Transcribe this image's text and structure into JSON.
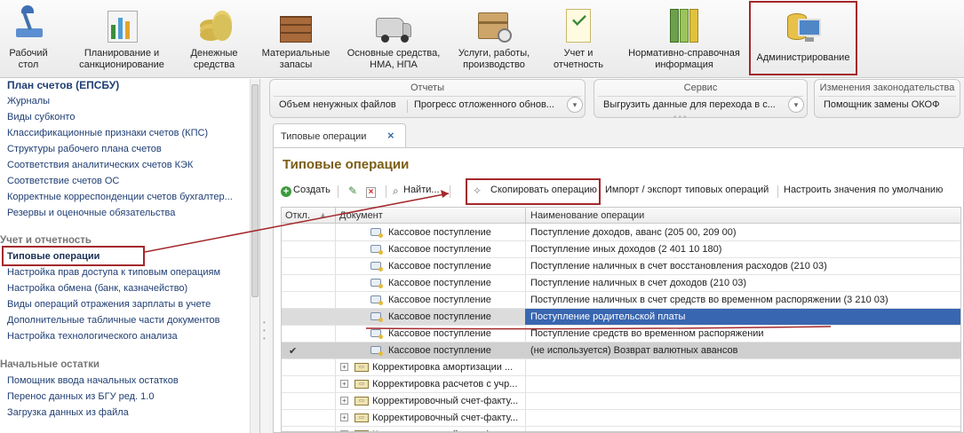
{
  "toolbar": {
    "items": [
      {
        "label": "Рабочий\nстол",
        "icon": "desk-lamp-icon"
      },
      {
        "label": "Планирование и\nсанкционирование",
        "icon": "chart-icon"
      },
      {
        "label": "Денежные\nсредства",
        "icon": "coins-icon"
      },
      {
        "label": "Материальные\nзапасы",
        "icon": "crate-icon"
      },
      {
        "label": "Основные средства,\nНМА, НПА",
        "icon": "van-icon"
      },
      {
        "label": "Услуги, работы,\nпроизводство",
        "icon": "box-icon"
      },
      {
        "label": "Учет и\nотчетность",
        "icon": "report-icon"
      },
      {
        "label": "Нормативно-справочная\nинформация",
        "icon": "binders-icon"
      },
      {
        "label": "Администрирование",
        "icon": "admin-database-icon"
      }
    ]
  },
  "sidebar": {
    "top_heading": "План счетов (ЕПСБУ)",
    "links1": [
      "Журналы",
      "Виды субконто",
      "Классификационные признаки счетов (КПС)",
      "Структуры рабочего плана счетов",
      "Соответствия аналитических счетов КЭК",
      "Соответствие счетов ОС",
      "Корректные корреспонденции счетов бухгалтер...",
      "Резервы и оценочные обязательства"
    ],
    "section2": "Учет и отчетность",
    "current": "Типовые операции",
    "links2": [
      "Настройка прав доступа к типовым операциям",
      "Настройка обмена (банк, казначейство)",
      "Виды операций отражения зарплаты в учете",
      "Дополнительные табличные части документов",
      "Настройка технологического анализа"
    ],
    "section3": "Начальные остатки",
    "links3": [
      "Помощник ввода начальных остатков",
      "Перенос данных из БГУ ред. 1.0",
      "Загрузка данных из файла"
    ]
  },
  "groups": {
    "reports": {
      "title": "Отчеты",
      "btn1": "Объем ненужных файлов",
      "btn2": "Прогресс отложенного обнов..."
    },
    "service": {
      "title": "Сервис",
      "btn1": "Выгрузить данные для перехода в с..."
    },
    "law": {
      "title": "Изменения законодательства",
      "btn1": "Помощник замены ОКОФ"
    }
  },
  "tab": {
    "label": "Типовые операции",
    "close": "×"
  },
  "form": {
    "title": "Типовые операции",
    "commands": {
      "create": "Создать",
      "find": "Найти...",
      "copy": "Скопировать операцию",
      "import_export": "Импорт / экспорт типовых операций",
      "defaults": "Настроить значения по умолчанию"
    }
  },
  "table": {
    "columns": [
      "Откл.",
      "Документ",
      "Наименование операции"
    ],
    "rows": [
      {
        "doc": "Кассовое поступление",
        "name": "Поступление доходов, аванс (205 00, 209 00)",
        "kind": "doc"
      },
      {
        "doc": "Кассовое поступление",
        "name": "Поступление иных доходов (2 401 10 180)",
        "kind": "doc"
      },
      {
        "doc": "Кассовое поступление",
        "name": "Поступление наличных в счет восстановления расходов (210 03)",
        "kind": "doc"
      },
      {
        "doc": "Кассовое поступление",
        "name": "Поступление наличных в счет доходов (210 03)",
        "kind": "doc"
      },
      {
        "doc": "Кассовое поступление",
        "name": "Поступление наличных в счет средств во временном распоряжении  (3 210 03)",
        "kind": "doc"
      },
      {
        "doc": "Кассовое поступление",
        "name": "Поступление родительской платы",
        "kind": "doc",
        "state": "selected"
      },
      {
        "doc": "Кассовое поступление",
        "name": "Поступление средств во временном распоряжении",
        "kind": "doc"
      },
      {
        "doc": "Кассовое поступление",
        "name": "(не используется) Возврат валютных авансов",
        "kind": "doc",
        "state": "disabled",
        "mark": "✔"
      },
      {
        "doc": "Корректировка амортизации ...",
        "name": "",
        "kind": "group"
      },
      {
        "doc": "Корректировка расчетов с учр...",
        "name": "",
        "kind": "group"
      },
      {
        "doc": "Корректировочный счет-факту...",
        "name": "",
        "kind": "group"
      },
      {
        "doc": "Корректировочный счет-факту...",
        "name": "",
        "kind": "group"
      },
      {
        "doc": "Корректировочный счет-факту...",
        "name": "",
        "kind": "group"
      }
    ]
  },
  "colors": {
    "highlight_red": "#a4282c",
    "selection_blue": "#3966b0",
    "title_brown": "#7c5e14",
    "link_blue": "#1f3e73"
  }
}
